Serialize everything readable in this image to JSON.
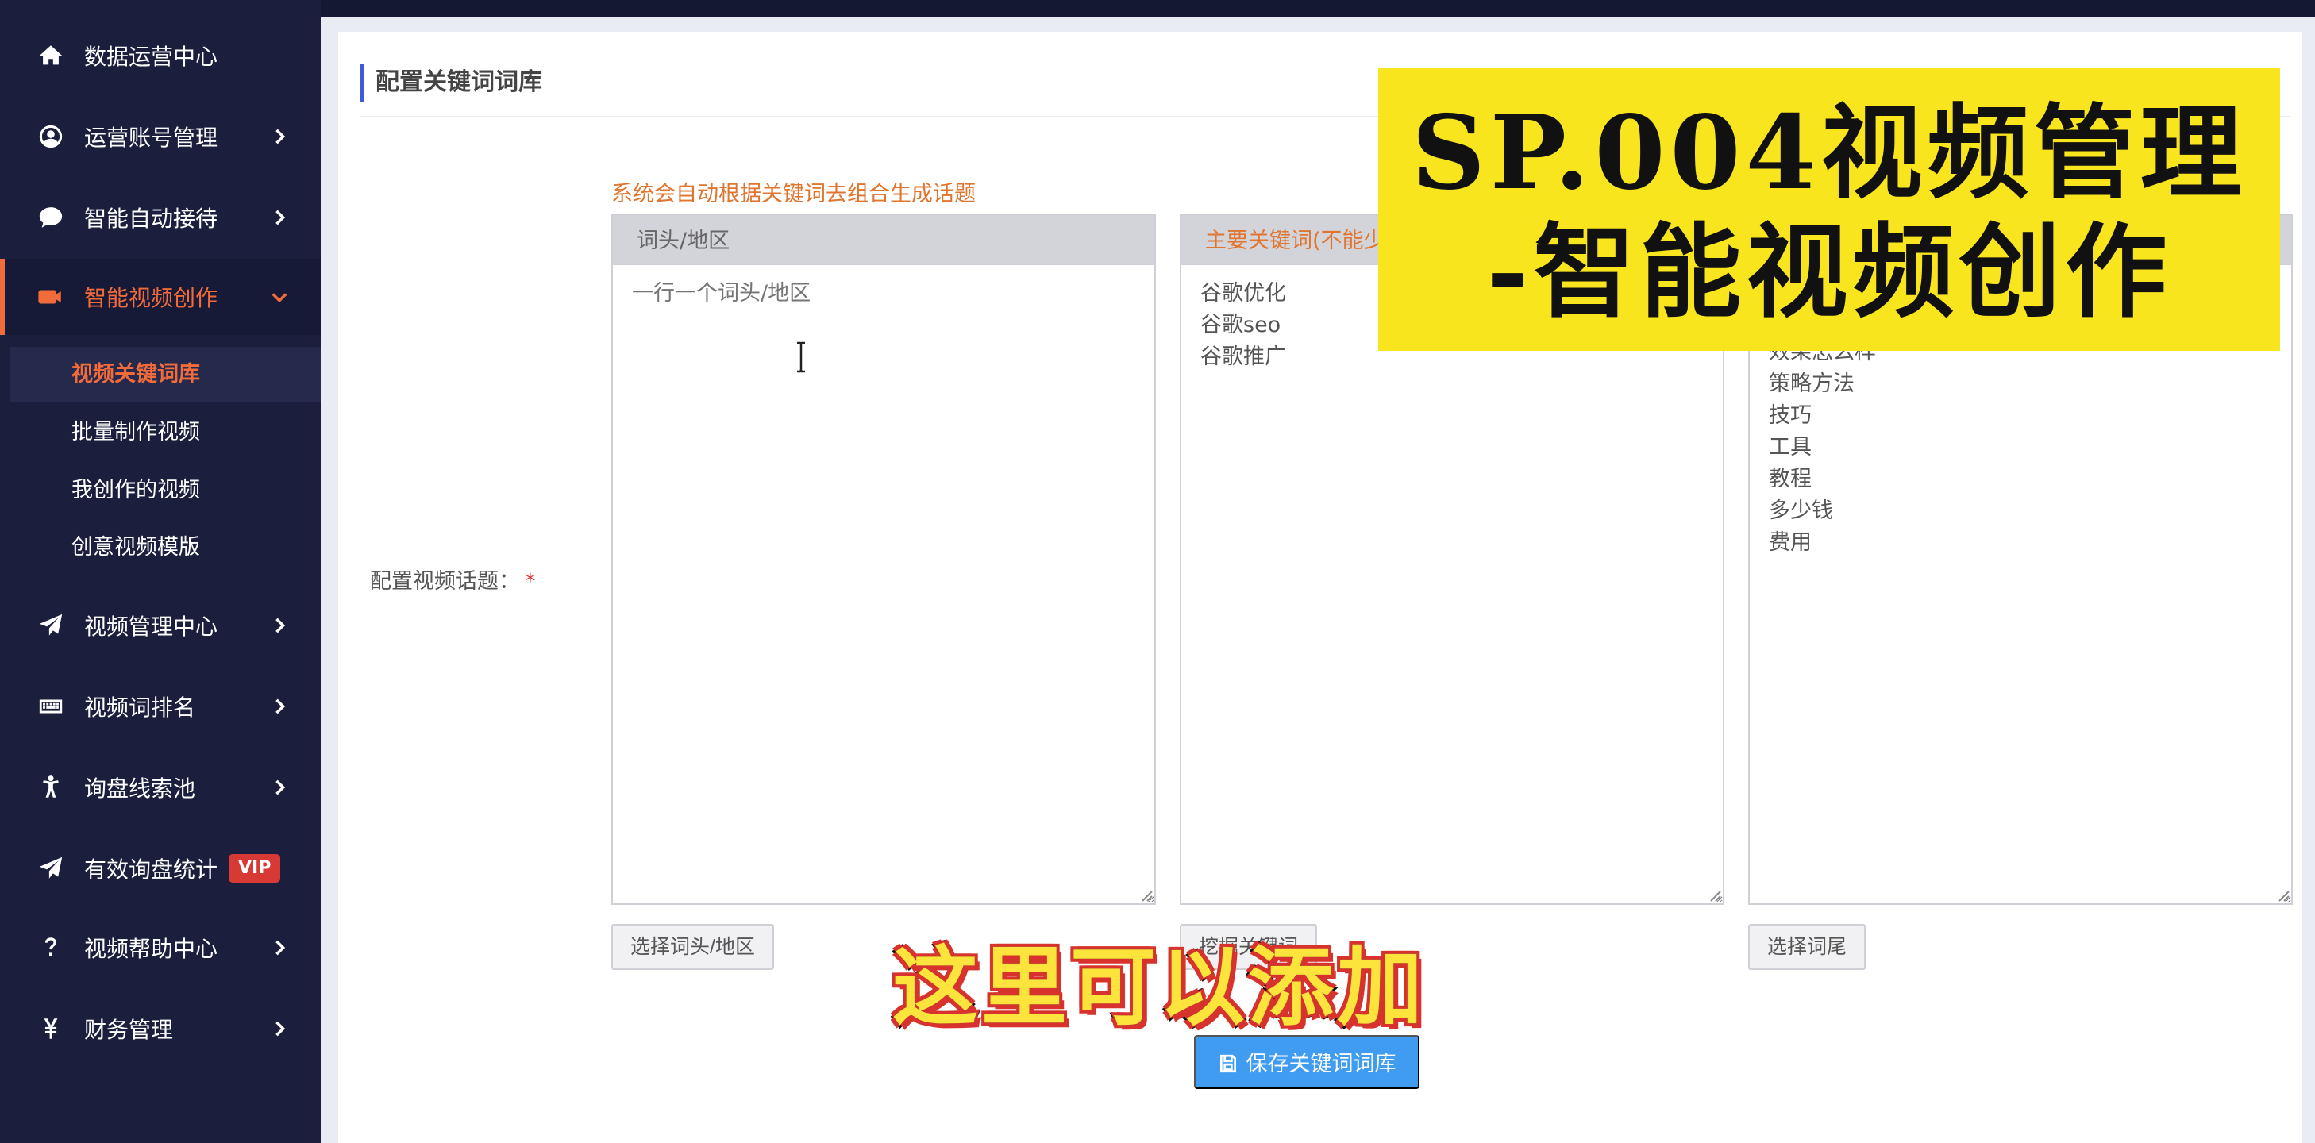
{
  "sidebar": {
    "items": [
      {
        "label": "数据运营中心",
        "icon": "home-icon"
      },
      {
        "label": "运营账号管理",
        "icon": "user-circle-icon"
      },
      {
        "label": "智能自动接待",
        "icon": "chat-bubble-icon"
      },
      {
        "label": "智能视频创作",
        "icon": "video-camera-icon"
      },
      {
        "label": "视频管理中心",
        "icon": "paper-plane-icon"
      },
      {
        "label": "视频词排名",
        "icon": "keyboard-icon"
      },
      {
        "label": "询盘线索池",
        "icon": "person-icon"
      },
      {
        "label": "有效询盘统计",
        "icon": "paper-plane-icon",
        "badge": "VIP"
      },
      {
        "label": "视频帮助中心",
        "icon": "question-icon"
      },
      {
        "label": "财务管理",
        "icon": "yen-icon"
      }
    ],
    "sub_items": [
      {
        "label": "视频关键词库"
      },
      {
        "label": "批量制作视频"
      },
      {
        "label": "我创作的视频"
      },
      {
        "label": "创意视频模版"
      }
    ]
  },
  "main": {
    "title": "配置关键词词库",
    "hint": "系统会自动根据关键词去组合生成话题",
    "form_label": "配置视频话题：",
    "required_mark": "*",
    "columns": [
      {
        "header": "词头/地区",
        "placeholder": "一行一个词头/地区",
        "lines": [],
        "button": "选择词头/地区"
      },
      {
        "header": "主要关键词(不能少",
        "lines": [
          "谷歌优化",
          "谷歌seo",
          "谷歌推广"
        ],
        "button": "挖掘关键词"
      },
      {
        "header": "",
        "lines": [
          "效果怎么样",
          "策略方法",
          "技巧",
          "工具",
          "教程",
          "多少钱",
          "费用"
        ],
        "button": "选择词尾"
      }
    ],
    "save_button": "保存关键词词库"
  },
  "overlay": {
    "title_line1": "SP.004视频管理",
    "title_line2": "-智能视频创作",
    "subtitle": "这里可以添加"
  },
  "colors": {
    "sidebar_bg": "#1b1e3d",
    "accent_orange": "#f26b3a",
    "primary_blue": "#409cf0",
    "banner_yellow": "#f9e51e",
    "vip_red": "#d73a35"
  }
}
